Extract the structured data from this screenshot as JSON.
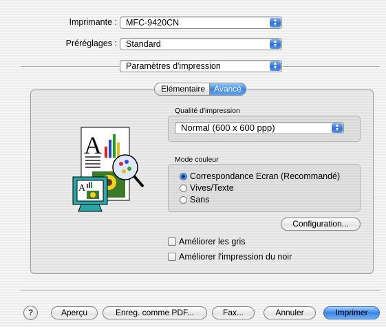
{
  "header": {
    "printer_label": "Imprimante :",
    "printer_value": "MFC-9420CN",
    "presets_label": "Préréglages :",
    "presets_value": "Standard",
    "section_value": "Paramètres d'impression"
  },
  "tabs": [
    {
      "label": "Elémentaire",
      "selected": false
    },
    {
      "label": "Avancé",
      "selected": true
    }
  ],
  "quality": {
    "label": "Qualité d'impression",
    "value": "Normal (600 x 600 ppp)"
  },
  "color_mode": {
    "label": "Mode couleur",
    "options": [
      {
        "label": "Correspondance Ecran (Recommandé)",
        "selected": true
      },
      {
        "label": "Vives/Texte",
        "selected": false
      },
      {
        "label": "Sans",
        "selected": false
      }
    ],
    "config_button": "Configuration..."
  },
  "checkboxes": [
    {
      "label": "Améliorer les gris",
      "checked": false
    },
    {
      "label": "Améliorer l'impression du noir",
      "checked": false
    }
  ],
  "footer": {
    "help": "?",
    "preview": "Aperçu",
    "save_pdf": "Enreg. comme PDF...",
    "fax": "Fax...",
    "cancel": "Annuler",
    "print": "Imprimer"
  },
  "colors": {
    "accent": "#3a86e6",
    "panel_border": "#9c9c9c"
  }
}
